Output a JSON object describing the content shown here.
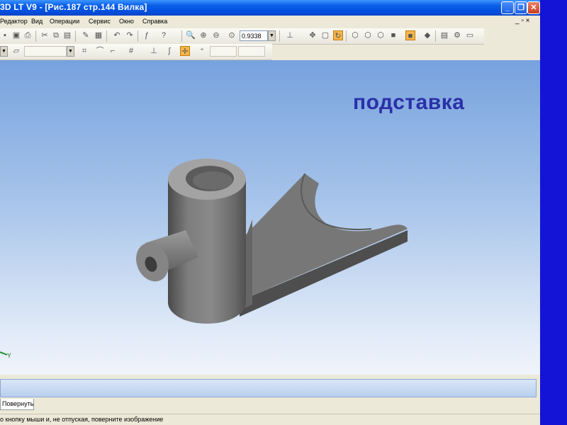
{
  "window": {
    "title": "3D LT V9 - [Рис.187  стр.144  Вилка]",
    "controls": {
      "minimize": "_",
      "maximize": "❐",
      "close": "✕"
    }
  },
  "menu": {
    "items": [
      "Редактор",
      "Вид",
      "Операции",
      "Сервис",
      "Окно",
      "Справка"
    ],
    "doc_controls": "_ ▫ ×"
  },
  "toolbar": {
    "zoom_value": "0.9338"
  },
  "viewport": {
    "slide_title": "подставка",
    "axis_label": "Y"
  },
  "tabs": [
    "Повернуть"
  ],
  "status": {
    "hint": "о кнопку мыши и, не отпуская, поверните изображение"
  },
  "colors": {
    "title_text": "#2b30a8",
    "titlebar": "#0a5fe8",
    "desktop": "#1414d6",
    "highlight_tool": "#f7b64a"
  }
}
